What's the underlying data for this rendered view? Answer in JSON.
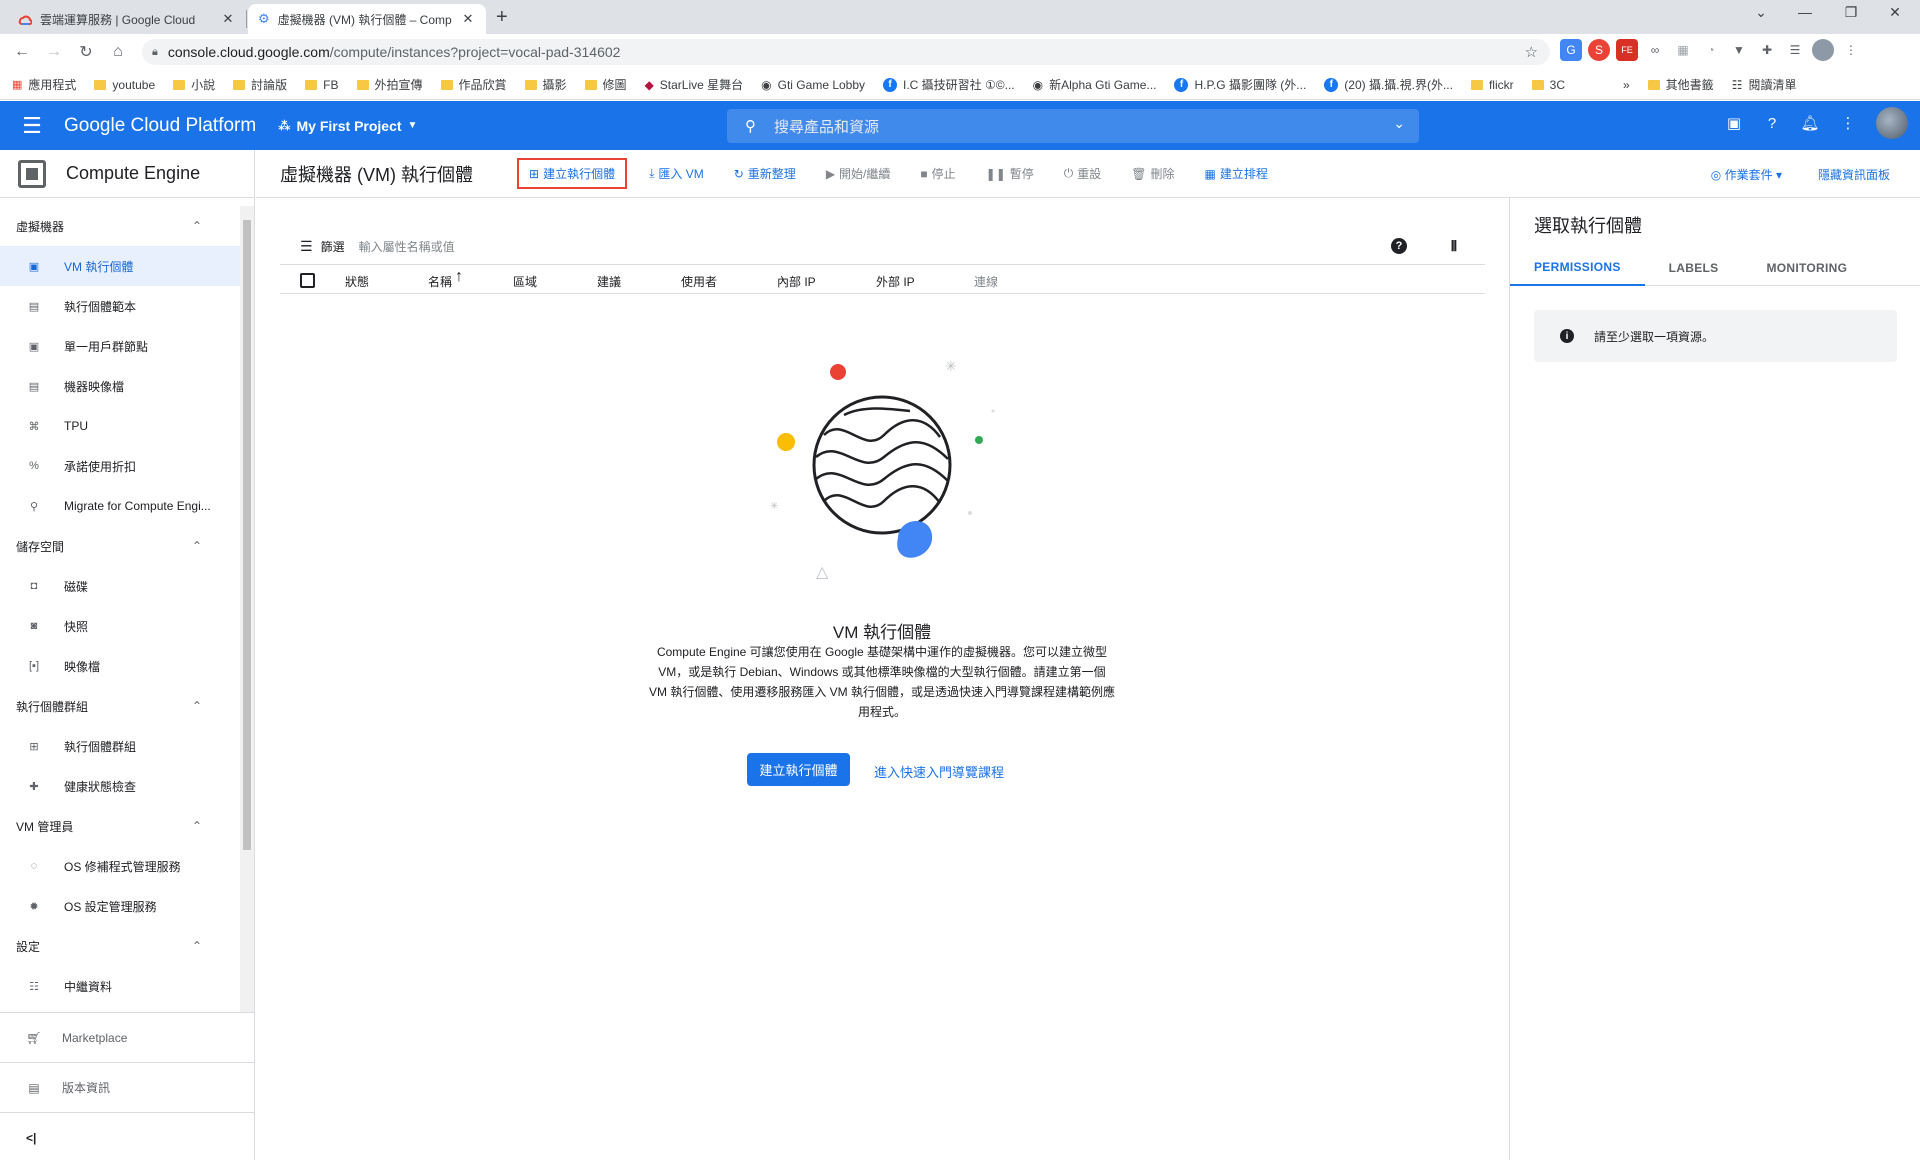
{
  "browser": {
    "tabs": [
      {
        "title": "雲端運算服務 | Google Cloud",
        "active": false
      },
      {
        "title": "虛擬機器 (VM) 執行個體 – Comp",
        "active": true
      }
    ],
    "url_host": "console.cloud.google.com",
    "url_path": "/compute/instances?project=vocal-pad-314602",
    "bookmarks": [
      "應用程式",
      "youtube",
      "小說",
      "討論版",
      "FB",
      "外拍宣傳",
      "作品欣賞",
      "攝影",
      "修圖",
      "StarLive 星舞台",
      "Gti Game Lobby",
      "I.C 攝技研習社 ①©...",
      "新Alpha Gti Game...",
      "H.P.G 攝影團隊 (外...",
      "(20) 攝.攝.視.界(外...",
      "flickr",
      "3C"
    ],
    "bookmarks_more": "»",
    "other_bookmarks": "其他書籤",
    "reading_list": "閱讀清單"
  },
  "header": {
    "brand": "Google Cloud Platform",
    "project": "My First Project",
    "search_placeholder": "搜尋產品和資源"
  },
  "sidebar": {
    "product": "Compute Engine",
    "sections": [
      {
        "title": "虛擬機器",
        "items": [
          "VM 執行個體",
          "執行個體範本",
          "單一用戶群節點",
          "機器映像檔",
          "TPU",
          "承諾使用折扣",
          "Migrate for Compute Engi..."
        ]
      },
      {
        "title": "儲存空間",
        "items": [
          "磁碟",
          "快照",
          "映像檔"
        ]
      },
      {
        "title": "執行個體群組",
        "items": [
          "執行個體群組",
          "健康狀態檢查"
        ]
      },
      {
        "title": "VM 管理員",
        "items": [
          "OS 修補程式管理服務",
          "OS 設定管理服務"
        ]
      },
      {
        "title": "設定",
        "items": [
          "中繼資料"
        ]
      }
    ],
    "marketplace": "Marketplace",
    "release_notes": "版本資訊",
    "collapse": "<|"
  },
  "toolbar": {
    "title": "虛擬機器 (VM) 執行個體",
    "create": "建立執行個體",
    "import_vm": "匯入 VM",
    "refresh": "重新整理",
    "start": "開始/繼續",
    "stop": "停止",
    "pause": "暫停",
    "reset": "重設",
    "delete": "刪除",
    "schedule": "建立排程",
    "operations": "作業套件",
    "hide_panel": "隱藏資訊面板"
  },
  "filter": {
    "label": "篩選",
    "placeholder": "輸入屬性名稱或值"
  },
  "table": {
    "columns": [
      "狀態",
      "名稱",
      "區域",
      "建議",
      "使用者",
      "內部 IP",
      "外部 IP",
      "連線"
    ]
  },
  "empty_state": {
    "title": "VM 執行個體",
    "description": "Compute Engine 可讓您使用在 Google 基礎架構中運作的虛擬機器。您可以建立微型 VM，或是執行 Debian、Windows 或其他標準映像檔的大型執行個體。請建立第一個 VM 執行個體、使用遷移服務匯入 VM 執行個體，或是透過快速入門導覽課程建構範例應用程式。",
    "create_button": "建立執行個體",
    "quickstart_link": "進入快速入門導覽課程"
  },
  "info_panel": {
    "title": "選取執行個體",
    "tabs": [
      "PERMISSIONS",
      "LABELS",
      "MONITORING"
    ],
    "note": "請至少選取一項資源。"
  },
  "colors": {
    "primary": "#1a73e8",
    "highlight_border": "#ea4335",
    "active_nav_bg": "#e8f0fe"
  }
}
